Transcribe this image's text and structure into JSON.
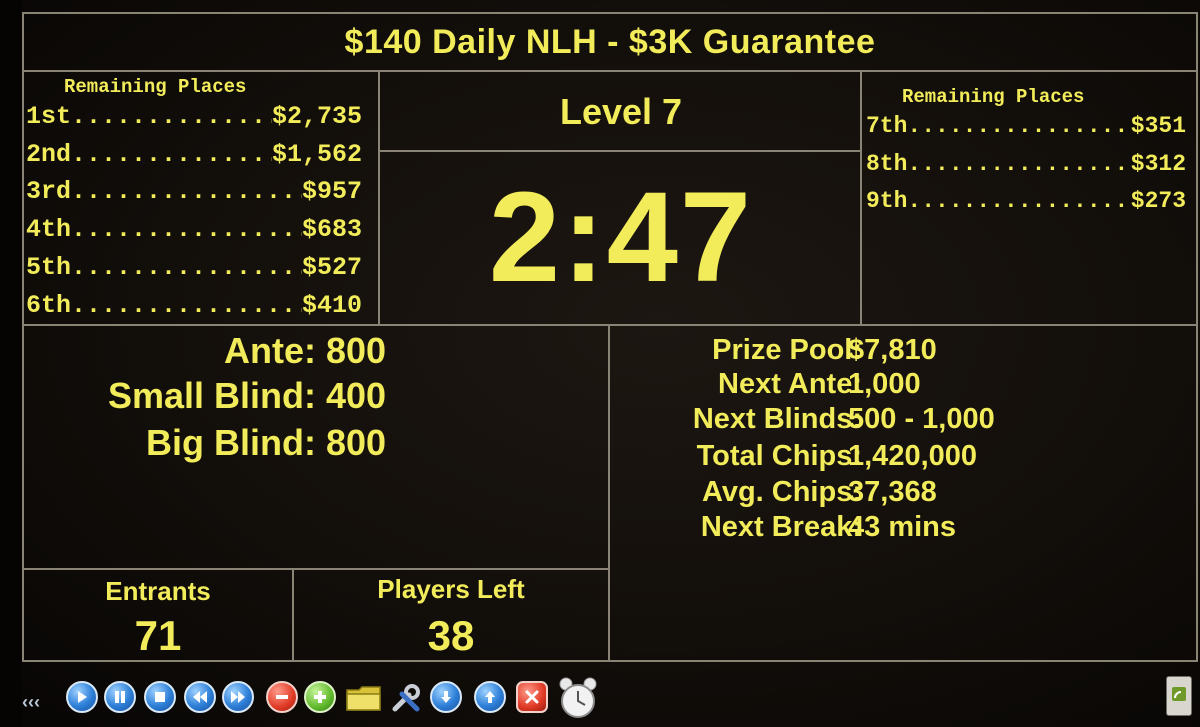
{
  "title": "$140 Daily NLH - $3K Guarantee",
  "left_places": {
    "heading": "Remaining Places",
    "rows": [
      {
        "rank": "1st",
        "amount": "$2,735"
      },
      {
        "rank": "2nd",
        "amount": "$1,562"
      },
      {
        "rank": "3rd",
        "amount": "$957"
      },
      {
        "rank": "4th",
        "amount": "$683"
      },
      {
        "rank": "5th",
        "amount": "$527"
      },
      {
        "rank": "6th",
        "amount": "$410"
      }
    ]
  },
  "right_places": {
    "heading": "Remaining Places",
    "rows": [
      {
        "rank": "7th",
        "amount": "$351"
      },
      {
        "rank": "8th",
        "amount": "$312"
      },
      {
        "rank": "9th",
        "amount": "$273"
      }
    ]
  },
  "level": "Level 7",
  "clock": "2:47",
  "blinds": {
    "ante_label": "Ante:",
    "ante": "800",
    "small_label": "Small Blind:",
    "small": "400",
    "big_label": "Big Blind:",
    "big": "800"
  },
  "stats": {
    "prize_pool_label": "Prize Pool:",
    "prize_pool": "$7,810",
    "next_ante_label": "Next Ante:",
    "next_ante": "1,000",
    "next_blinds_label": "Next Blinds:",
    "next_blinds": "500 - 1,000",
    "total_chips_label": "Total Chips:",
    "total_chips": "1,420,000",
    "avg_chips_label": "Avg. Chips:",
    "avg_chips": "37,368",
    "next_break_label": "Next Break:",
    "next_break": "43 mins"
  },
  "entrants": {
    "label": "Entrants",
    "value": "71"
  },
  "players_left": {
    "label": "Players Left",
    "value": "38"
  },
  "toolbar": {
    "collapse_glyph": "‹‹‹",
    "buttons": [
      "play-icon",
      "pause-icon",
      "stop-icon",
      "rewind-icon",
      "fast-forward-icon",
      "remove-icon",
      "add-icon",
      "folder-icon",
      "tools-icon",
      "download-icon",
      "upload-icon",
      "close-icon",
      "alarm-clock-icon",
      "feed-icon"
    ]
  },
  "colors": {
    "text": "#f2ec5a",
    "lines": "#8a8476",
    "background": "#120e0a"
  }
}
